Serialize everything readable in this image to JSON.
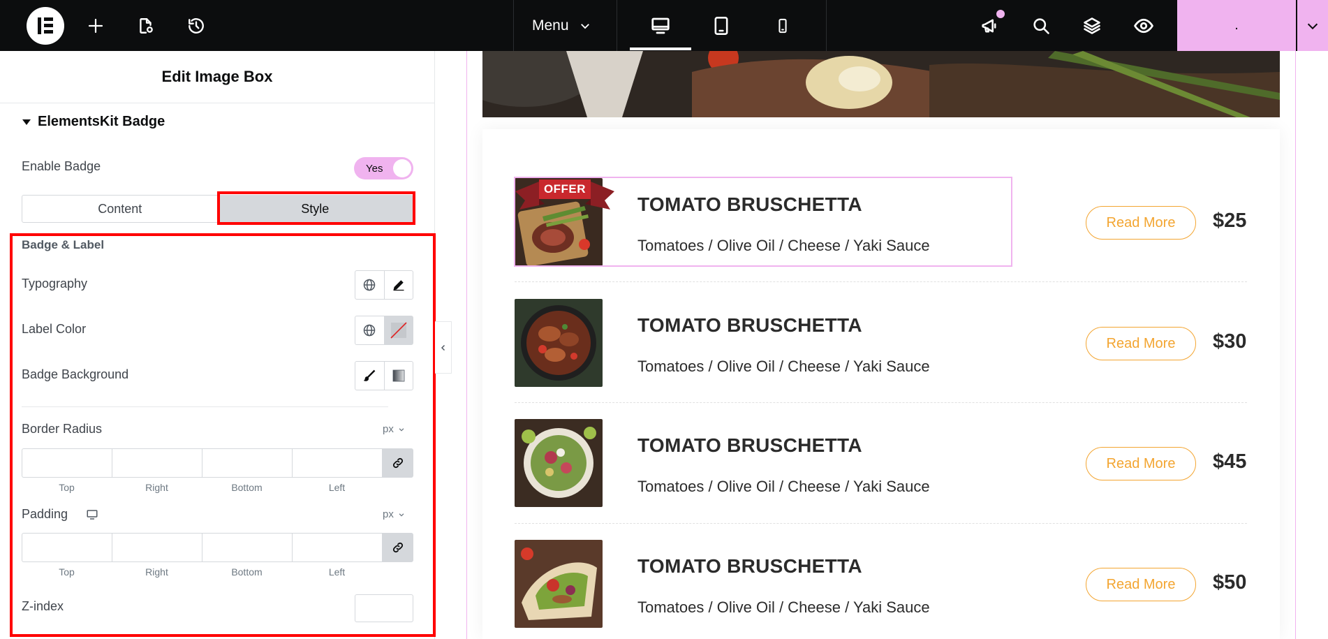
{
  "topbar": {
    "menu_label": "Menu",
    "publish_label": "."
  },
  "panel": {
    "title": "Edit Image Box",
    "section_title": "ElementsKit Badge",
    "enable_badge_label": "Enable Badge",
    "enable_badge_value": "Yes",
    "tabs": [
      "Content",
      "Style"
    ],
    "active_tab": "Style",
    "badge_label_heading": "Badge & Label",
    "typography_label": "Typography",
    "label_color_label": "Label Color",
    "badge_background_label": "Badge Background",
    "border_radius": {
      "label": "Border Radius",
      "unit": "px",
      "fields": [
        "Top",
        "Right",
        "Bottom",
        "Left"
      ],
      "values": [
        "",
        "",
        "",
        ""
      ]
    },
    "padding": {
      "label": "Padding",
      "unit": "px",
      "fields": [
        "Top",
        "Right",
        "Bottom",
        "Left"
      ],
      "values": [
        "",
        "",
        "",
        ""
      ]
    },
    "zindex_label": "Z-index",
    "zindex_value": ""
  },
  "canvas": {
    "badge_text": "OFFER",
    "items": [
      {
        "name": "TOMATO BRUSCHETTA",
        "desc": "Tomatoes / Olive Oil / Cheese / Yaki Sauce",
        "button": "Read More",
        "price": "$25"
      },
      {
        "name": "TOMATO BRUSCHETTA",
        "desc": "Tomatoes / Olive Oil / Cheese / Yaki Sauce",
        "button": "Read More",
        "price": "$30"
      },
      {
        "name": "TOMATO BRUSCHETTA",
        "desc": "Tomatoes / Olive Oil / Cheese / Yaki Sauce",
        "button": "Read More",
        "price": "$45"
      },
      {
        "name": "TOMATO BRUSCHETTA",
        "desc": "Tomatoes / Olive Oil / Cheese / Yaki Sauce",
        "button": "Read More",
        "price": "$50"
      }
    ]
  },
  "colors": {
    "accent_pink": "#f0b3ef",
    "button_orange": "#f3a531",
    "highlight_red": "#ff0000",
    "topbar_bg": "#0c0d0e"
  },
  "icons": {
    "topbar": [
      "elementor-logo-icon",
      "plus-icon",
      "page-settings-icon",
      "history-icon",
      "chevron-down-icon",
      "desktop-icon",
      "tablet-icon",
      "mobile-icon",
      "megaphone-icon",
      "search-icon",
      "layers-icon",
      "eye-icon"
    ],
    "panel": [
      "globe-icon",
      "pencil-icon",
      "paintbrush-icon",
      "gradient-icon",
      "link-icon",
      "desktop-icon",
      "chevron-left-icon"
    ]
  }
}
